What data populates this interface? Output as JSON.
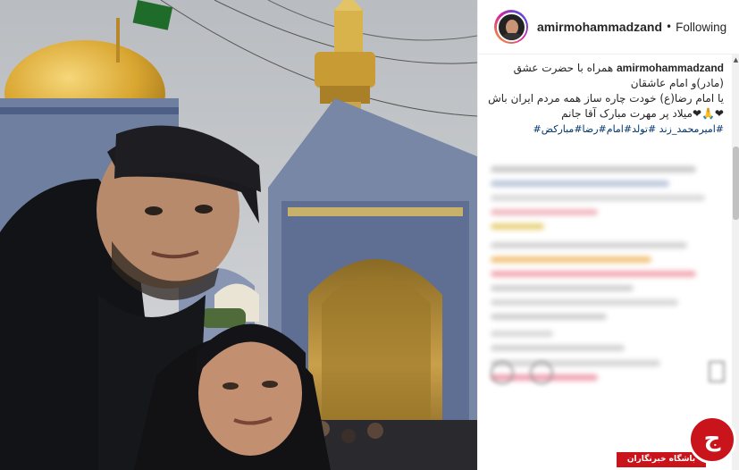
{
  "post": {
    "username": "amirmohammadzand",
    "separator": "•",
    "follow_status": "Following"
  },
  "caption": {
    "user": "amirmohammadzand",
    "line1": "همراه با حضرت عشق",
    "line2": "(مادر)و امام عاشقان",
    "line3": "یا امام رضا(ع) خودت چاره ساز همه مردم ایران باش",
    "line4": "❤🙏❤میلاد پر مهرت مبارک آقا جانم",
    "hashtags": "#امیرمحمد_زند #تولد#امام#رضا#مبارکض#"
  },
  "watermark": {
    "label": "باشگاه خبرنگاران",
    "logo_letter": "ج"
  },
  "colors": {
    "accent": "#c8141a",
    "hashtag": "#003569",
    "text": "#262626"
  }
}
